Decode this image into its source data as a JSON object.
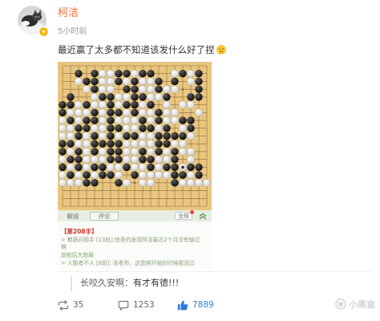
{
  "post": {
    "author": {
      "name": "柯洁",
      "verified_icon": "verified-badge-icon"
    },
    "time": "5小时前",
    "text": "最近赢了太多都不知道该发什么好了捏",
    "emoji_icon": "face-emoji-icon",
    "image": {
      "board": {
        "stones": [
          [
            0,
            0,
            0,
            0,
            0,
            0,
            0,
            0,
            0,
            0,
            0,
            0,
            0,
            0,
            0,
            0,
            0,
            0,
            0
          ],
          [
            0,
            0,
            1,
            0,
            1,
            2,
            2,
            1,
            1,
            2,
            1,
            1,
            0,
            0,
            2,
            1,
            2,
            1,
            0
          ],
          [
            0,
            0,
            2,
            1,
            1,
            2,
            2,
            1,
            2,
            1,
            2,
            2,
            1,
            0,
            1,
            0,
            2,
            1,
            0
          ],
          [
            0,
            0,
            0,
            2,
            1,
            2,
            2,
            0,
            1,
            1,
            2,
            2,
            1,
            2,
            2,
            0,
            0,
            1,
            0
          ],
          [
            0,
            1,
            0,
            0,
            2,
            1,
            1,
            2,
            2,
            1,
            1,
            2,
            2,
            1,
            0,
            0,
            1,
            1,
            0
          ],
          [
            1,
            1,
            2,
            1,
            2,
            2,
            1,
            2,
            1,
            1,
            2,
            1,
            0,
            2,
            0,
            2,
            2,
            0,
            0
          ],
          [
            1,
            2,
            2,
            2,
            1,
            2,
            1,
            1,
            2,
            1,
            2,
            2,
            1,
            2,
            2,
            0,
            0,
            2,
            0
          ],
          [
            2,
            1,
            2,
            1,
            1,
            2,
            1,
            2,
            2,
            2,
            1,
            2,
            1,
            2,
            2,
            1,
            1,
            0,
            0
          ],
          [
            2,
            2,
            1,
            1,
            2,
            2,
            1,
            1,
            2,
            2,
            1,
            1,
            2,
            1,
            0,
            2,
            1,
            0,
            0
          ],
          [
            2,
            2,
            1,
            2,
            1,
            2,
            1,
            2,
            1,
            1,
            2,
            2,
            1,
            1,
            1,
            1,
            2,
            0,
            0
          ],
          [
            1,
            1,
            2,
            2,
            1,
            1,
            1,
            1,
            2,
            2,
            2,
            2,
            1,
            1,
            2,
            2,
            0,
            0,
            0
          ],
          [
            1,
            2,
            1,
            2,
            1,
            2,
            1,
            1,
            2,
            2,
            1,
            2,
            1,
            2,
            1,
            2,
            2,
            0,
            0
          ],
          [
            2,
            1,
            1,
            2,
            2,
            2,
            1,
            1,
            2,
            2,
            1,
            1,
            2,
            2,
            1,
            0,
            2,
            0,
            0
          ],
          [
            1,
            2,
            1,
            2,
            1,
            1,
            2,
            2,
            1,
            2,
            2,
            1,
            2,
            1,
            1,
            2,
            1,
            1,
            0
          ],
          [
            2,
            1,
            2,
            1,
            2,
            1,
            1,
            2,
            0,
            1,
            2,
            2,
            2,
            2,
            1,
            1,
            2,
            1,
            0
          ],
          [
            2,
            2,
            2,
            1,
            1,
            0,
            0,
            1,
            2,
            0,
            2,
            2,
            0,
            0,
            1,
            2,
            2,
            2,
            2
          ],
          [
            0,
            0,
            0,
            0,
            0,
            0,
            0,
            0,
            0,
            0,
            0,
            0,
            0,
            0,
            0,
            0,
            0,
            0,
            0
          ],
          [
            0,
            0,
            0,
            0,
            0,
            0,
            0,
            0,
            0,
            0,
            0,
            0,
            0,
            0,
            0,
            0,
            0,
            0,
            0
          ],
          [
            0,
            0,
            0,
            0,
            0,
            0,
            0,
            0,
            0,
            0,
            0,
            0,
            0,
            0,
            0,
            0,
            0,
            0,
            0
          ]
        ],
        "last_move": [
          13,
          15
        ]
      },
      "tabs": [
        {
          "label": "解说",
          "selected": false
        },
        {
          "label": "评论",
          "selected": true
        }
      ],
      "filter_label": "全部",
      "collapse_icon": "double-chevron-up-icon",
      "move_heading": "【第208手】",
      "lines": [
        {
          "text": "> 都蔬问题手 [13段]:惊奇的发现阿洁最近2个月没有输过",
          "color": "#8aa07c"
        },
        {
          "text": "棋",
          "color": "#8aa07c"
        },
        {
          "text": "前柏后大炮局",
          "color": "#6fae5c"
        },
        {
          "text": "> 人骸者不人 [6段]: 张老师，这盘棋开始的时候我说过",
          "color": "#8aa07c"
        }
      ]
    }
  },
  "comment": {
    "user": "长咬久安啊：",
    "text": "有才有德!!!"
  },
  "actions": {
    "repost": {
      "icon": "repost-icon",
      "count": "35"
    },
    "comment": {
      "icon": "comment-icon",
      "count": "1253"
    },
    "like": {
      "icon": "thumbs-up-icon",
      "count": "7889"
    }
  },
  "watermark": {
    "icon": "xiaoheihe-logo-icon",
    "text": "小黑盒"
  },
  "colors": {
    "username": "#f0703c",
    "time": "#9a9a9a",
    "text": "#333333",
    "badge": "#f6b300",
    "board": "#e9c67f",
    "grid": "#8c6b3b",
    "tab_bar": "#e7eee2",
    "move_heading": "#c8372d",
    "last_move_marker": "#222222",
    "action": "#777777",
    "like": "#2f7bd8"
  }
}
